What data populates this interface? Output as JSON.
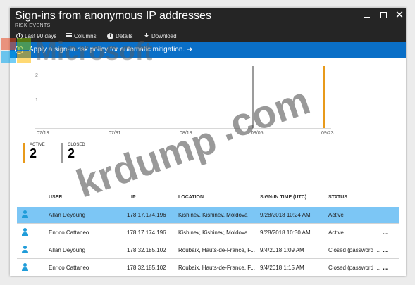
{
  "window": {
    "title": "Sign-ins from anonymous IP addresses",
    "subtitle": "RISK EVENTS",
    "controls": {
      "close": "✕"
    }
  },
  "toolbar": {
    "range_label": "Last 90 days",
    "columns_label": "Columns",
    "details_label": "Details",
    "download_label": "Download"
  },
  "banner": {
    "text": "Apply a sign-in risk policy for automatic mitigation. ➔"
  },
  "chart_data": {
    "type": "bar",
    "y_ticks": [
      "2",
      "1"
    ],
    "ylim": [
      0,
      2
    ],
    "x_tick_labels": [
      "07/13",
      "07/31",
      "08/18",
      "09/05",
      "09/23"
    ],
    "series": [
      {
        "name": "ACTIVE",
        "color": "#e89a1b",
        "points": [
          {
            "x": "09/28",
            "y": 2
          }
        ]
      },
      {
        "name": "CLOSED",
        "color": "#9c9c9c",
        "points": [
          {
            "x": "09/04",
            "y": 2
          }
        ]
      }
    ]
  },
  "legend": {
    "active": {
      "label": "ACTIVE",
      "value": "2",
      "color": "#e89a1b"
    },
    "closed": {
      "label": "CLOSED",
      "value": "2",
      "color": "#9c9c9c"
    }
  },
  "table": {
    "headers": {
      "user": "USER",
      "ip": "IP",
      "location": "LOCATION",
      "time": "SIGN-IN TIME (UTC)",
      "status": "STATUS"
    },
    "rows": [
      {
        "user": "Allan Deyoung",
        "ip": "178.17.174.196",
        "location": "Kishinev, Kishinev, Moldova",
        "time": "9/28/2018 10:24 AM",
        "status": "Active",
        "more": ""
      },
      {
        "user": "Enrico Cattaneo",
        "ip": "178.17.174.196",
        "location": "Kishinev, Kishinev, Moldova",
        "time": "9/28/2018 10:30 AM",
        "status": "Active",
        "more": "..."
      },
      {
        "user": "Allan Deyoung",
        "ip": "178.32.185.102",
        "location": "Roubaix, Hauts-de-France, F...",
        "time": "9/4/2018 1:09 AM",
        "status": "Closed (password ...",
        "more": "..."
      },
      {
        "user": "Enrico Cattaneo",
        "ip": "178.32.185.102",
        "location": "Roubaix, Hauts-de-France, F...",
        "time": "9/4/2018 1:15 AM",
        "status": "Closed (password ...",
        "more": "..."
      }
    ]
  },
  "watermarks": {
    "brand": "Microsoft",
    "site1": "krdump",
    "site2": ".com"
  }
}
